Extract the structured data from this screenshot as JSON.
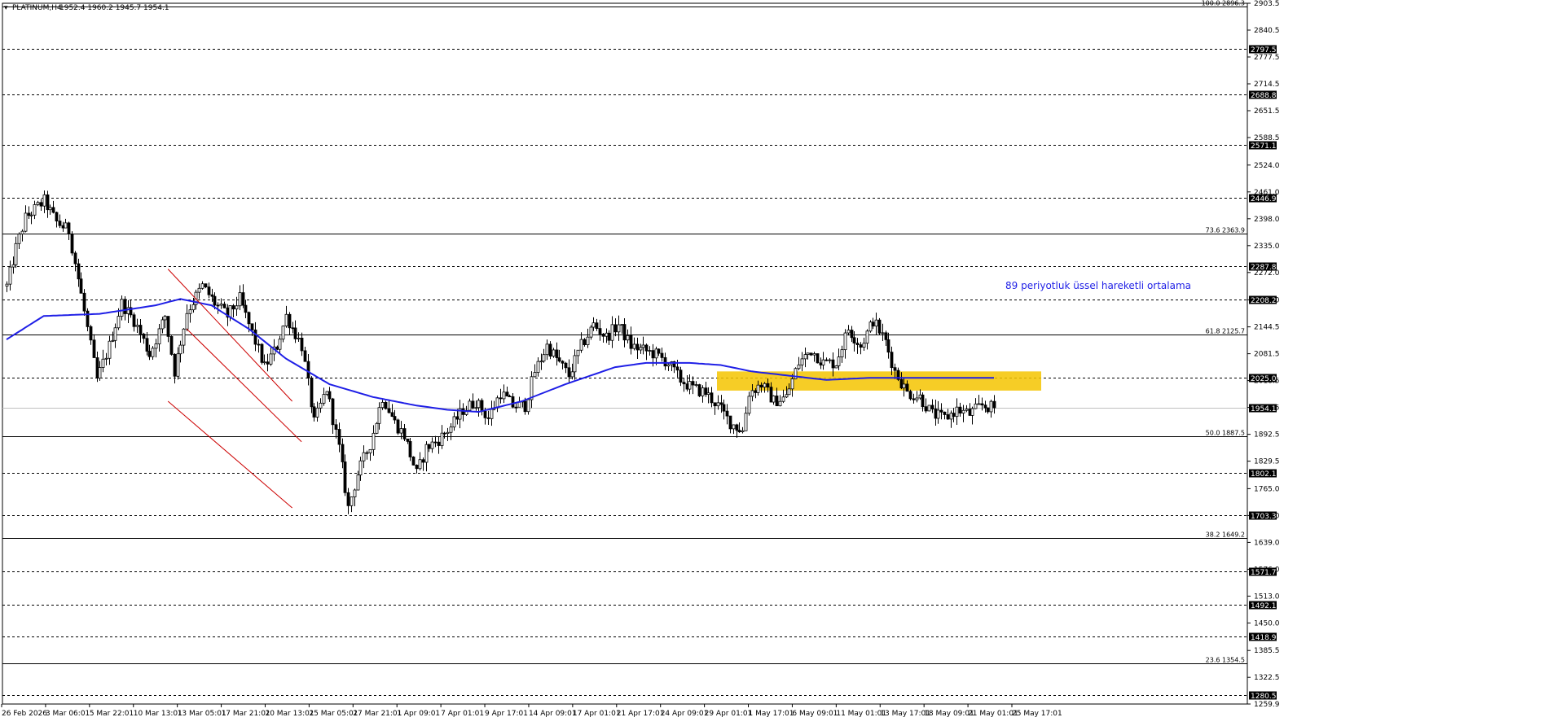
{
  "header": {
    "symbol": "PLATINUM,H4",
    "ohlc": "1952.4 1960.2 1945.7 1954.1"
  },
  "annotation": "89 periyotluk üssel hareketli ortalama",
  "colors": {
    "candle": "#000000",
    "ema": "#1f1fe6",
    "channel": "#cc0000",
    "zone": "#f5c400",
    "grid_dotted": "#000000",
    "solid_line": "#000000",
    "price_line": "#c0c0c0"
  },
  "chart_data": {
    "type": "candlestick",
    "y_range": [
      1259.9,
      2903.5
    ],
    "y_axis_ticks": [
      "2903.5",
      "2840.5",
      "2777.5",
      "2714.5",
      "2651.5",
      "2588.5",
      "2524.0",
      "2461.0",
      "2398.0",
      "2335.0",
      "2272.0",
      "2208.0",
      "2144.5",
      "2081.5",
      "2018.5",
      "1955.5",
      "1892.5",
      "1829.5",
      "1765.0",
      "1702.0",
      "1639.0",
      "1576.0",
      "1513.0",
      "1450.0",
      "1385.5",
      "1322.5",
      "1259.9"
    ],
    "x_axis_labels": [
      "26 Feb 2026",
      "3 Mar 06:01",
      "5 Mar 22:01",
      "10 Mar 13:01",
      "13 Mar 05:01",
      "17 Mar 21:01",
      "20 Mar 13:01",
      "25 Mar 05:01",
      "27 Mar 21:01",
      "1 Apr 09:01",
      "7 Apr 01:01",
      "9 Apr 17:01",
      "14 Apr 09:01",
      "17 Apr 01:01",
      "21 Apr 17:01",
      "24 Apr 09:01",
      "29 Apr 01:01",
      "1 May 17:01",
      "6 May 09:01",
      "11 May 01:01",
      "13 May 17:01",
      "18 May 09:01",
      "21 May 01:01",
      "25 May 17:01"
    ],
    "horizontal_levels_dotted": [
      {
        "value": 2797.5,
        "label": "2797.5"
      },
      {
        "value": 2688.8,
        "label": "2688.8"
      },
      {
        "value": 2571.1,
        "label": "2571.1"
      },
      {
        "value": 2446.9,
        "label": "2446.9"
      },
      {
        "value": 2287.8,
        "label": "2287.8"
      },
      {
        "value": 2208.2,
        "label": "2208.2"
      },
      {
        "value": 2025.0,
        "label": "2025.0"
      },
      {
        "value": 1802.1,
        "label": "1802.1"
      },
      {
        "value": 1703.3,
        "label": "1703.3"
      },
      {
        "value": 1571.7,
        "label": "1571.7"
      },
      {
        "value": 1492.1,
        "label": "1492.1"
      },
      {
        "value": 1418.9,
        "label": "1418.9"
      },
      {
        "value": 1280.5,
        "label": "1280.5"
      }
    ],
    "fibonacci_levels": [
      {
        "value": 2896.3,
        "label": "100.0 2896.3"
      },
      {
        "value": 2363.9,
        "label": "73.6 2363.9"
      },
      {
        "value": 2125.7,
        "label": "61.8 2125.7"
      },
      {
        "value": 1887.5,
        "label": "50.0 1887.5"
      },
      {
        "value": 1649.2,
        "label": "38.2 1649.2"
      },
      {
        "value": 1354.5,
        "label": "23.6 1354.5"
      }
    ],
    "current_price": {
      "value": 1954.1,
      "label": "1954.1"
    },
    "zone": {
      "from": 1995,
      "to": 2040
    },
    "anchors": [
      [
        0,
        2240
      ],
      [
        3,
        2330
      ],
      [
        6,
        2400
      ],
      [
        12,
        2440
      ],
      [
        16,
        2390
      ],
      [
        20,
        2370
      ],
      [
        24,
        2220
      ],
      [
        29,
        2020
      ],
      [
        33,
        2100
      ],
      [
        37,
        2200
      ],
      [
        41,
        2160
      ],
      [
        46,
        2080
      ],
      [
        51,
        2170
      ],
      [
        54,
        2040
      ],
      [
        58,
        2180
      ],
      [
        63,
        2240
      ],
      [
        67,
        2200
      ],
      [
        71,
        2170
      ],
      [
        75,
        2210
      ],
      [
        79,
        2130
      ],
      [
        83,
        2050
      ],
      [
        87,
        2100
      ],
      [
        90,
        2170
      ],
      [
        95,
        2100
      ],
      [
        99,
        1920
      ],
      [
        103,
        2000
      ],
      [
        107,
        1860
      ],
      [
        110,
        1720
      ],
      [
        113,
        1800
      ],
      [
        117,
        1870
      ],
      [
        121,
        1980
      ],
      [
        125,
        1920
      ],
      [
        128,
        1890
      ],
      [
        132,
        1800
      ],
      [
        135,
        1860
      ],
      [
        139,
        1880
      ],
      [
        143,
        1910
      ],
      [
        147,
        1950
      ],
      [
        151,
        1970
      ],
      [
        155,
        1930
      ],
      [
        159,
        1990
      ],
      [
        163,
        1960
      ],
      [
        167,
        1960
      ],
      [
        170,
        2040
      ],
      [
        174,
        2100
      ],
      [
        177,
        2070
      ],
      [
        181,
        2030
      ],
      [
        185,
        2100
      ],
      [
        189,
        2150
      ],
      [
        193,
        2120
      ],
      [
        197,
        2150
      ],
      [
        201,
        2100
      ],
      [
        205,
        2090
      ],
      [
        209,
        2080
      ],
      [
        213,
        2060
      ],
      [
        217,
        2020
      ],
      [
        221,
        2000
      ],
      [
        225,
        1990
      ],
      [
        229,
        1960
      ],
      [
        233,
        1920
      ],
      [
        237,
        1900
      ],
      [
        239,
        1990
      ],
      [
        243,
        2010
      ],
      [
        247,
        1970
      ],
      [
        251,
        1980
      ],
      [
        255,
        2060
      ],
      [
        259,
        2090
      ],
      [
        263,
        2060
      ],
      [
        267,
        2060
      ],
      [
        271,
        2140
      ],
      [
        275,
        2100
      ],
      [
        279,
        2160
      ],
      [
        283,
        2110
      ],
      [
        286,
        2040
      ],
      [
        290,
        1990
      ],
      [
        294,
        1980
      ],
      [
        298,
        1940
      ],
      [
        302,
        1930
      ],
      [
        306,
        1950
      ],
      [
        310,
        1940
      ],
      [
        314,
        1960
      ],
      [
        318,
        1954
      ]
    ],
    "ema_anchors": [
      [
        0,
        2115
      ],
      [
        12,
        2170
      ],
      [
        30,
        2175
      ],
      [
        48,
        2195
      ],
      [
        56,
        2210
      ],
      [
        66,
        2195
      ],
      [
        78,
        2140
      ],
      [
        90,
        2070
      ],
      [
        104,
        2010
      ],
      [
        118,
        1980
      ],
      [
        132,
        1960
      ],
      [
        142,
        1950
      ],
      [
        152,
        1945
      ],
      [
        166,
        1970
      ],
      [
        180,
        2010
      ],
      [
        196,
        2050
      ],
      [
        206,
        2060
      ],
      [
        220,
        2060
      ],
      [
        230,
        2055
      ],
      [
        240,
        2040
      ],
      [
        252,
        2030
      ],
      [
        264,
        2020
      ],
      [
        278,
        2025
      ],
      [
        292,
        2025
      ],
      [
        306,
        2025
      ],
      [
        318,
        2025
      ]
    ],
    "channel_lines": [
      {
        "from": [
          52,
          2280
        ],
        "to": [
          92,
          1970
        ]
      },
      {
        "from": [
          58,
          2140
        ],
        "to": [
          95,
          1875
        ]
      },
      {
        "from": [
          52,
          1970
        ],
        "to": [
          92,
          1720
        ]
      }
    ],
    "candle_count": 320
  }
}
